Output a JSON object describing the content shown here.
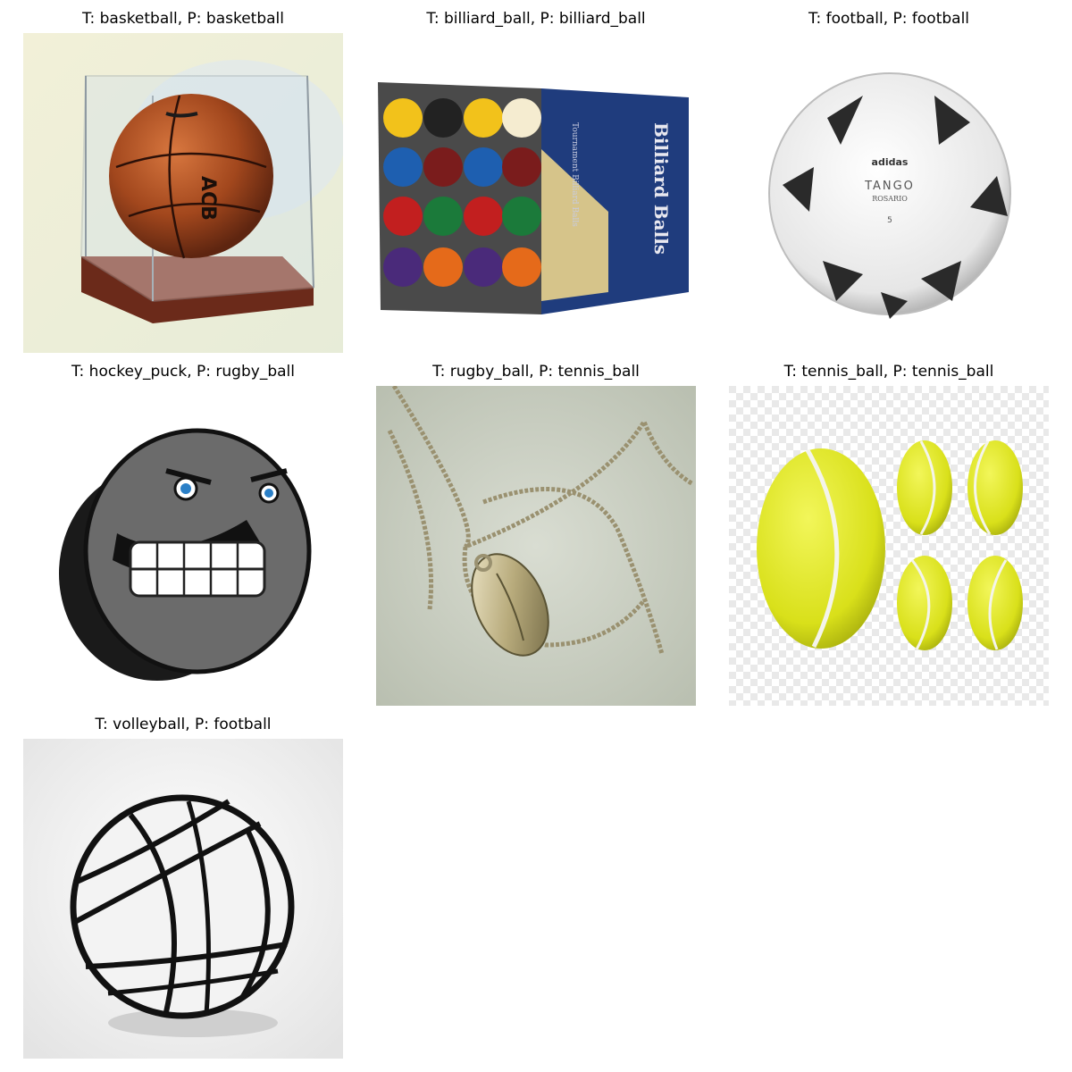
{
  "panels": [
    {
      "caption": "T: basketball, P: basketball",
      "true_label": "basketball",
      "pred_label": "basketball"
    },
    {
      "caption": "T: billiard_ball, P: billiard_ball",
      "true_label": "billiard_ball",
      "pred_label": "billiard_ball"
    },
    {
      "caption": "T: football, P: football",
      "true_label": "football",
      "pred_label": "football"
    },
    {
      "caption": "T: hockey_puck, P: rugby_ball",
      "true_label": "hockey_puck",
      "pred_label": "rugby_ball"
    },
    {
      "caption": "T: rugby_ball, P: tennis_ball",
      "true_label": "rugby_ball",
      "pred_label": "tennis_ball"
    },
    {
      "caption": "T: tennis_ball, P: tennis_ball",
      "true_label": "tennis_ball",
      "pred_label": "tennis_ball"
    },
    {
      "caption": "T: volleyball, P: football",
      "true_label": "volleyball",
      "pred_label": "football"
    }
  ],
  "image_text": {
    "billiard_box_title": "Billiard Balls",
    "billiard_box_subtitle": "Tournament Billiard Balls",
    "football_brand": "adidas",
    "football_model": "TANGO",
    "football_submodel": "ROSARIO",
    "football_size": "5",
    "basketball_logo": "ACB"
  }
}
